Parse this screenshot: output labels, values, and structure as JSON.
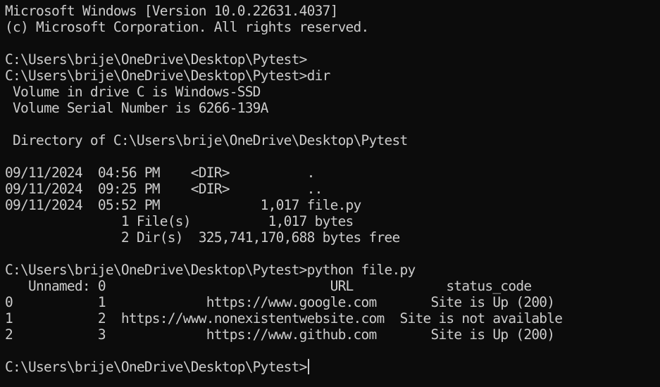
{
  "terminal": {
    "lines": [
      "Microsoft Windows [Version 10.0.22631.4037]",
      "(c) Microsoft Corporation. All rights reserved.",
      "",
      "C:\\Users\\brije\\OneDrive\\Desktop\\Pytest>",
      "C:\\Users\\brije\\OneDrive\\Desktop\\Pytest>dir",
      " Volume in drive C is Windows-SSD",
      " Volume Serial Number is 6266-139A",
      "",
      " Directory of C:\\Users\\brije\\OneDrive\\Desktop\\Pytest",
      "",
      "09/11/2024  04:56 PM    <DIR>          .",
      "09/11/2024  09:25 PM    <DIR>          ..",
      "09/11/2024  05:52 PM             1,017 file.py",
      "               1 File(s)          1,017 bytes",
      "               2 Dir(s)  325,741,170,688 bytes free",
      "",
      "C:\\Users\\brije\\OneDrive\\Desktop\\Pytest>python file.py",
      "   Unnamed: 0                             URL            status_code",
      "0           1             https://www.google.com       Site is Up (200)",
      "1           2  https://www.nonexistentwebsite.com  Site is not available",
      "2           3             https://www.github.com       Site is Up (200)",
      ""
    ],
    "prompt": "C:\\Users\\brije\\OneDrive\\Desktop\\Pytest>"
  }
}
